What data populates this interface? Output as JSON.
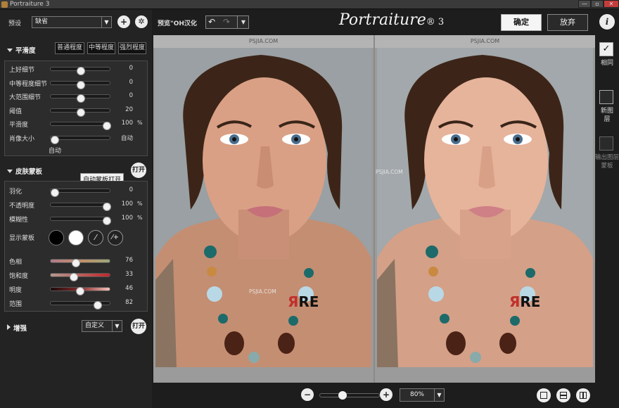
{
  "window": {
    "title": "Portraiture 3",
    "controls": [
      "—",
      "▫",
      "✕"
    ]
  },
  "preset": {
    "label": "预设",
    "value": "缺省"
  },
  "smoothing": {
    "header": "平滑度",
    "levels": [
      "普通程度",
      "中等程度",
      "强烈程度"
    ],
    "sliders": [
      {
        "label": "上好细节",
        "value": "0",
        "unit": "",
        "frac": 0.5
      },
      {
        "label": "中等程度细节",
        "value": "0",
        "unit": "",
        "frac": 0.5
      },
      {
        "label": "大范围细节",
        "value": "0",
        "unit": "",
        "frac": 0.5
      },
      {
        "label": "阈值",
        "value": "20",
        "unit": "",
        "frac": 0.5
      },
      {
        "label": "平滑度",
        "value": "100",
        "unit": "%",
        "frac": 1.0
      },
      {
        "label": "肖像大小",
        "value": "自动",
        "unit": "",
        "frac": 0.0
      }
    ],
    "portrait_size_note": "自动"
  },
  "skin_mask": {
    "header": "皮肤蒙板",
    "tooltip": "自动蒙板打开",
    "open_label": "打开",
    "sliders": [
      {
        "label": "羽化",
        "value": "0",
        "unit": "",
        "frac": 0.0
      },
      {
        "label": "不透明度",
        "value": "100",
        "unit": "%",
        "frac": 1.0
      },
      {
        "label": "模糊性",
        "value": "100",
        "unit": "%",
        "frac": 1.0
      }
    ],
    "show_mask_label": "显示蒙板",
    "color_sliders": [
      {
        "label": "色相",
        "value": "76",
        "frac": 0.4
      },
      {
        "label": "饱和度",
        "value": "33",
        "frac": 0.36
      },
      {
        "label": "明度",
        "value": "46",
        "frac": 0.48
      },
      {
        "label": "范围",
        "value": "82",
        "frac": 0.82
      }
    ]
  },
  "enhance": {
    "header": "增强",
    "select_value": "自定义",
    "open_label": "打开"
  },
  "toolbar": {
    "preview_label": "预览\"OH汉化",
    "brand": "Portraiture",
    "brand_version": "® 3",
    "ok_label": "确定",
    "cancel_label": "放弃"
  },
  "viewer": {
    "pane_header": "PSJIA.COM",
    "watermark": "PSJIA.COM",
    "logo_text": "ЯRE"
  },
  "right_panel": {
    "same_label": "相同",
    "new_layer_label": "新图层",
    "output_mask_label": "输出图层蒙板"
  },
  "zoom": {
    "value": "80%",
    "frac": 0.35
  },
  "colors": {
    "accent": "#f5f5f5",
    "panel": "#2c2c2c"
  }
}
